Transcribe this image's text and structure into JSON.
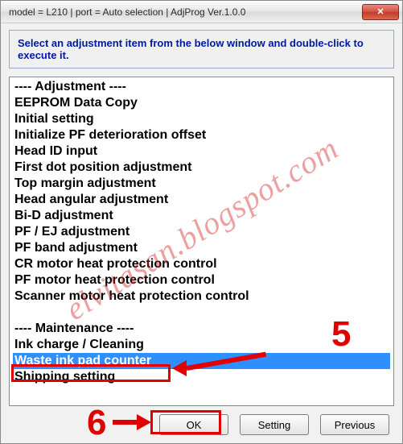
{
  "window": {
    "title": "model = L210 | port = Auto selection | AdjProg Ver.1.0.0"
  },
  "instruction": "Select an adjustment item from the below window and double-click to execute it.",
  "list_items": [
    {
      "label": "---- Adjustment ----",
      "selected": false
    },
    {
      "label": "EEPROM Data Copy",
      "selected": false
    },
    {
      "label": "Initial setting",
      "selected": false
    },
    {
      "label": "Initialize PF deterioration offset",
      "selected": false
    },
    {
      "label": "Head ID input",
      "selected": false
    },
    {
      "label": "First dot position adjustment",
      "selected": false
    },
    {
      "label": "Top margin adjustment",
      "selected": false
    },
    {
      "label": "Head angular adjustment",
      "selected": false
    },
    {
      "label": "Bi-D adjustment",
      "selected": false
    },
    {
      "label": "PF / EJ adjustment",
      "selected": false
    },
    {
      "label": "PF band adjustment",
      "selected": false
    },
    {
      "label": "CR motor heat protection control",
      "selected": false
    },
    {
      "label": "PF motor heat protection control",
      "selected": false
    },
    {
      "label": "Scanner motor heat protection control",
      "selected": false
    },
    {
      "label": "",
      "selected": false
    },
    {
      "label": "---- Maintenance ----",
      "selected": false
    },
    {
      "label": "Ink charge / Cleaning",
      "selected": false
    },
    {
      "label": "Waste ink pad counter",
      "selected": true
    },
    {
      "label": "Shipping setting",
      "selected": false
    }
  ],
  "buttons": {
    "ok": "OK",
    "setting": "Setting",
    "previous": "Previous"
  },
  "annotations": {
    "num5": "5",
    "num6": "6"
  },
  "watermark": "elvitasan.blogspot.com"
}
